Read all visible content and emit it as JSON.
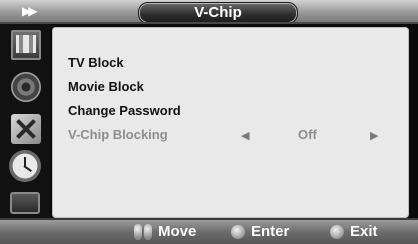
{
  "header": {
    "title": "V-Chip",
    "skip_glyph": "▶▶"
  },
  "sidebar": {
    "icons": [
      "tv-picture-icon",
      "sound-icon",
      "setup-tools-icon",
      "clock-icon",
      "input-icon"
    ]
  },
  "menu": {
    "items": [
      {
        "label": "TV Block",
        "state": "enabled"
      },
      {
        "label": "Movie Block",
        "state": "enabled"
      },
      {
        "label": "Change Password",
        "state": "enabled"
      },
      {
        "label": "V-Chip Blocking",
        "state": "disabled",
        "value": "Off",
        "left_arrow": "◀",
        "right_arrow": "▶"
      }
    ]
  },
  "footer": {
    "move_label": "Move",
    "enter_label": "Enter",
    "exit_label": "Exit"
  },
  "colors": {
    "panel_bg": "#e9e9e9",
    "frame_bg": "#0a0a0a",
    "dim_text": "#8d8d8d"
  }
}
